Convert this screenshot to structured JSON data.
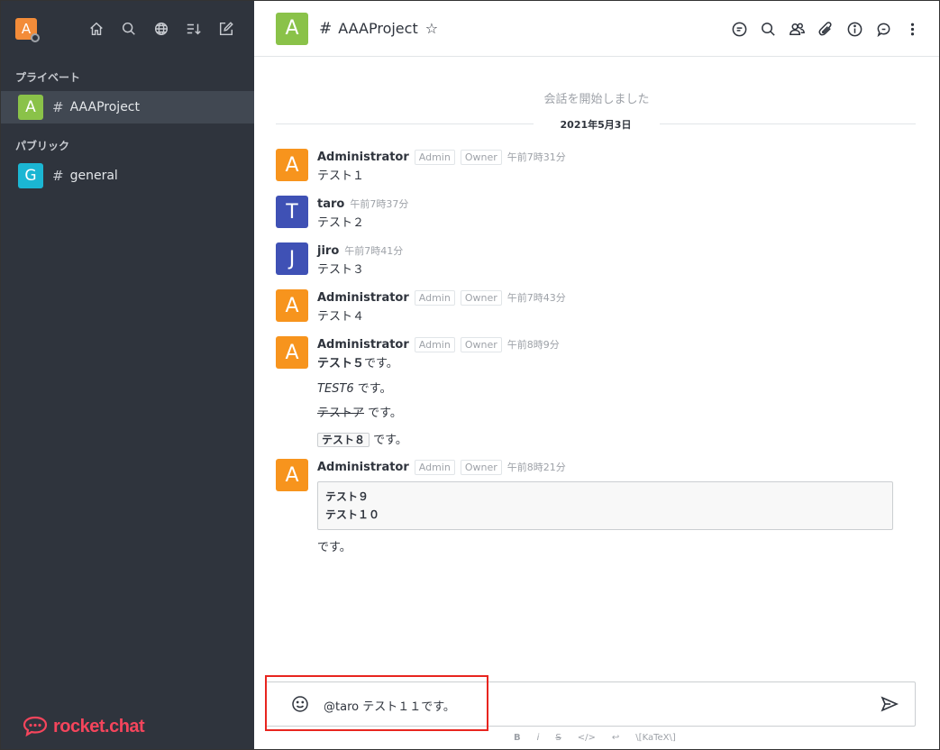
{
  "sidebar": {
    "user_avatar_letter": "A",
    "sections": {
      "private_label": "プライベート",
      "public_label": "パブリック"
    },
    "rooms": [
      {
        "letter": "A",
        "hash": "#",
        "name": "AAAProject",
        "color": "#8ac249"
      },
      {
        "letter": "G",
        "hash": "#",
        "name": "general",
        "color": "#1bb6d3"
      }
    ],
    "brand": "rocket.chat"
  },
  "header": {
    "avatar_letter": "A",
    "hash": "#",
    "title": "AAAProject",
    "star": "☆"
  },
  "conversation": {
    "start_label": "会話を開始しました",
    "date": "2021年5月3日"
  },
  "messages": [
    {
      "letter": "A",
      "color": "#f7941d",
      "user": "Administrator",
      "roles": [
        "Admin",
        "Owner"
      ],
      "time": "午前7時31分",
      "text": "テスト１"
    },
    {
      "letter": "T",
      "color": "#3f51b5",
      "user": "taro",
      "roles": [],
      "time": "午前7時37分",
      "text": "テスト２"
    },
    {
      "letter": "J",
      "color": "#3f51b5",
      "user": "jiro",
      "roles": [],
      "time": "午前7時41分",
      "text": "テスト３"
    },
    {
      "letter": "A",
      "color": "#f7941d",
      "user": "Administrator",
      "roles": [
        "Admin",
        "Owner"
      ],
      "time": "午前7時43分",
      "text": "テスト４"
    },
    {
      "letter": "A",
      "color": "#f7941d",
      "user": "Administrator",
      "roles": [
        "Admin",
        "Owner"
      ],
      "time": "午前8時9分",
      "lines": {
        "l1_bold": "テスト５",
        "l1_rest": "です。",
        "l2_italic": "TEST6",
        "l2_rest": " です。",
        "l3_strike": "テストア",
        "l3_rest": " です。",
        "l4_code": "テスト８",
        "l4_rest": " です。"
      }
    },
    {
      "letter": "A",
      "color": "#f7941d",
      "user": "Administrator",
      "roles": [
        "Admin",
        "Owner"
      ],
      "time": "午前8時21分",
      "code_lines": [
        "テスト９",
        "テスト１０"
      ],
      "after": "です。"
    }
  ],
  "composer": {
    "value": "@taro テスト１１です。",
    "format_buttons": [
      "B",
      "i",
      "S",
      "</>",
      "↩",
      "\\[KaTeX\\]"
    ]
  }
}
